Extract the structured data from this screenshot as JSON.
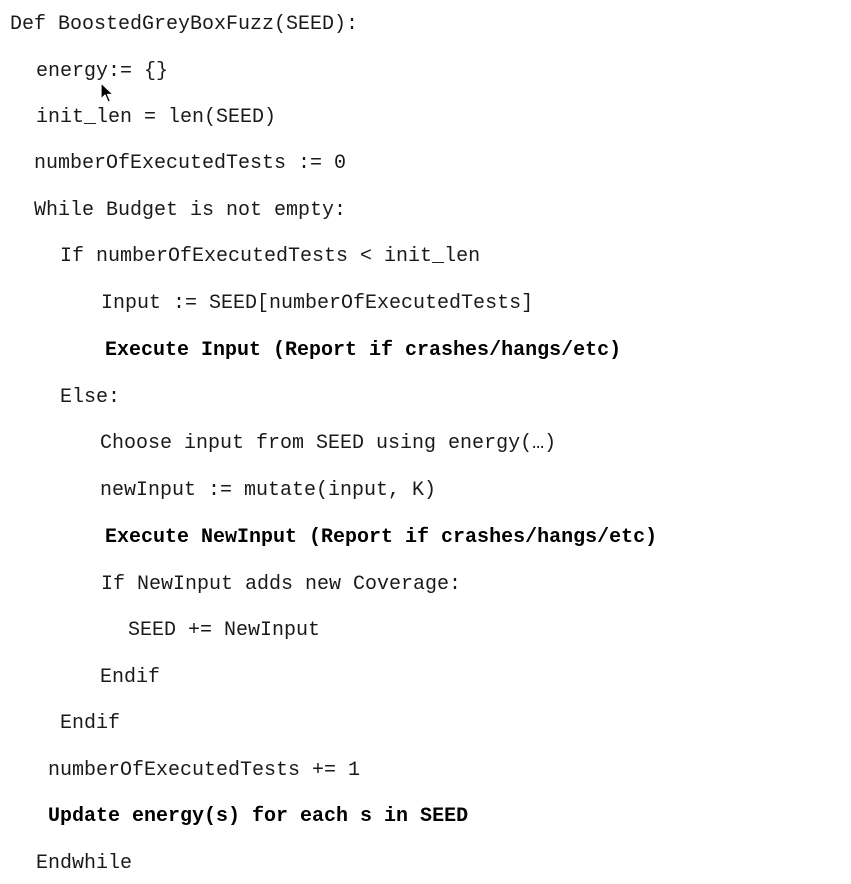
{
  "code": {
    "lines": [
      {
        "text": "Def BoostedGreyBoxFuzz(SEED):",
        "bold": false
      },
      {
        "text": "energy:= {}",
        "bold": false
      },
      {
        "text": "init_len = len(SEED)",
        "bold": false
      },
      {
        "text": "numberOfExecutedTests := 0",
        "bold": false
      },
      {
        "text": "While Budget is not empty:",
        "bold": false
      },
      {
        "text": "If numberOfExecutedTests < init_len",
        "bold": false
      },
      {
        "text": "Input := SEED[numberOfExecutedTests]",
        "bold": false
      },
      {
        "text": "Execute Input (Report if crashes/hangs/etc)",
        "bold": true
      },
      {
        "text": "Else:",
        "bold": false
      },
      {
        "text": "Choose input from SEED using energy(…)",
        "bold": false
      },
      {
        "text": "newInput := mutate(input, K)",
        "bold": false
      },
      {
        "text": "Execute NewInput (Report if crashes/hangs/etc)",
        "bold": true
      },
      {
        "text": "If NewInput adds new Coverage:",
        "bold": false
      },
      {
        "text": "SEED += NewInput",
        "bold": false
      },
      {
        "text": "Endif",
        "bold": false
      },
      {
        "text": "Endif",
        "bold": false
      },
      {
        "text": "numberOfExecutedTests += 1",
        "bold": false
      },
      {
        "text": "Update energy(s) for each s in SEED",
        "bold": true
      },
      {
        "text": "Endwhile",
        "bold": false
      }
    ]
  },
  "cursor": {
    "icon": "mouse-pointer-icon"
  }
}
